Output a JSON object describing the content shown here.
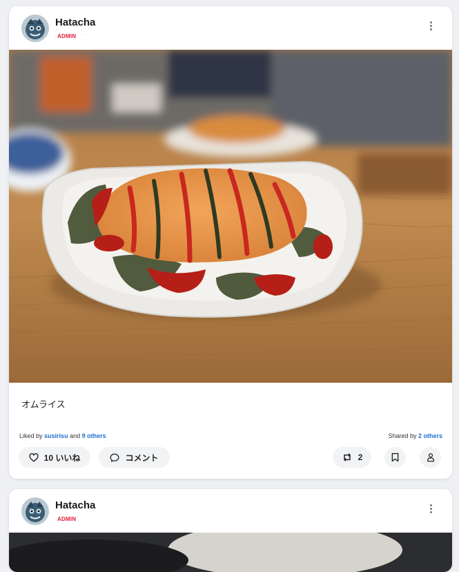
{
  "posts": [
    {
      "author": {
        "name": "Hatacha",
        "role": "ADMIN",
        "role_separator": "·"
      },
      "caption": "オムライス",
      "likes": {
        "prefix": "Liked by",
        "first_user": "susirisu",
        "joiner": "and",
        "others": "9 others"
      },
      "shares": {
        "prefix": "Shared by",
        "others": "2 others"
      },
      "actions": {
        "like_label": "10 いいね",
        "comment_label": "コメント",
        "share_count": "2"
      },
      "image_description": "omurice-on-plate"
    },
    {
      "author": {
        "name": "Hatacha",
        "role": "ADMIN"
      }
    }
  ],
  "icons": {
    "menu": "vertical-dots-icon",
    "like": "heart-icon",
    "comment": "speech-bubble-icon",
    "share": "repost-icon",
    "save": "bookmark-icon",
    "share_user": "user-icon"
  },
  "colors": {
    "admin_badge": "#e11d3c",
    "link": "#1f6fd1",
    "pill_bg": "#f2f3f5"
  }
}
